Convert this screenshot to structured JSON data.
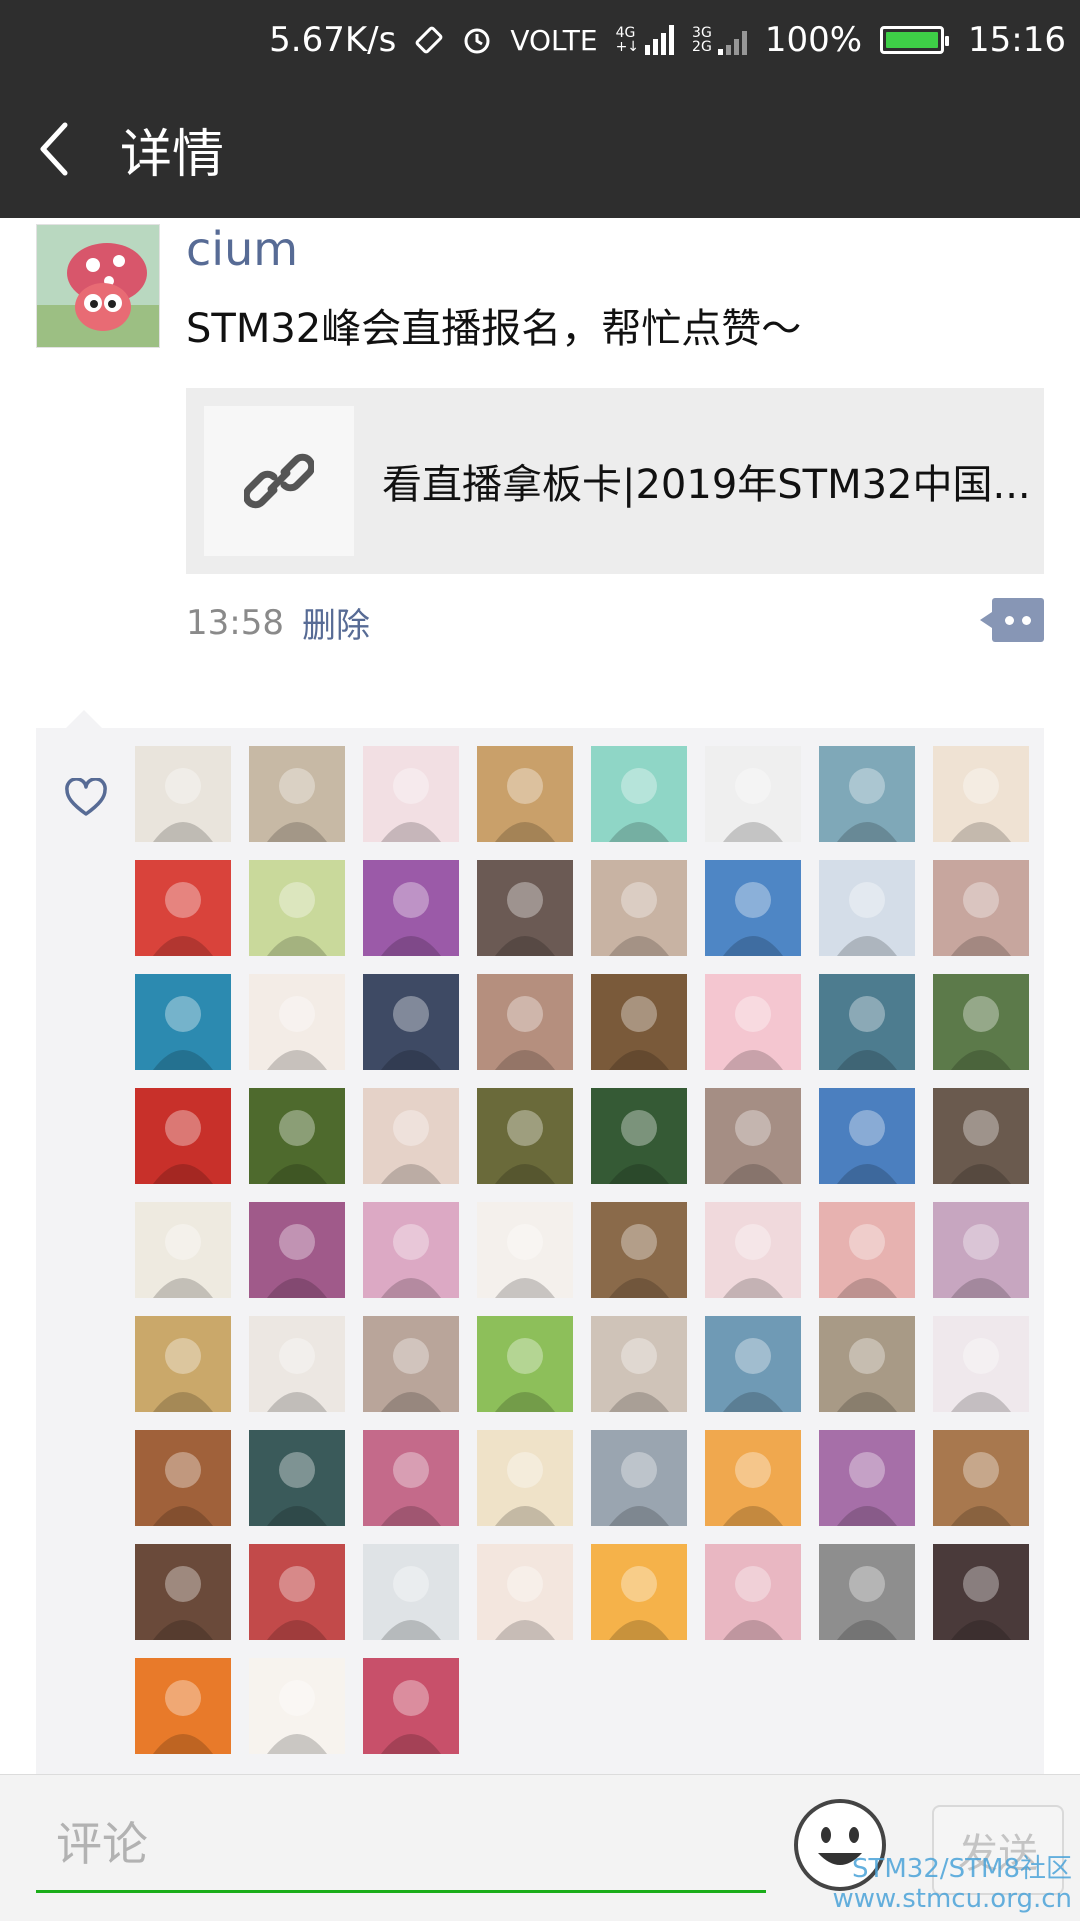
{
  "status_bar": {
    "speed": "5.67K/s",
    "volte": "VOLTE",
    "sim1_label_top": "4G",
    "sim1_label_bottom": "+↓",
    "sim2_label_top": "3G",
    "sim2_label_bottom": "2G",
    "battery": "100%",
    "battery_level": 1.0,
    "time": "15:16",
    "icons": [
      "rotate-icon",
      "alarm-icon",
      "signal-icon",
      "battery-icon"
    ]
  },
  "header": {
    "title": "详情"
  },
  "post": {
    "username": "cium",
    "text": "STM32峰会直播报名，帮忙点赞～",
    "link_title": "看直播拿板卡|2019年STM32中国...",
    "time": "13:58",
    "delete_label": "删除"
  },
  "likes": {
    "count": 67,
    "icon": "heart-icon"
  },
  "comment_bar": {
    "placeholder": "评论",
    "send_label": "发送",
    "emoji_icon": "smiley-icon"
  },
  "watermark": {
    "line1": "STM32/STM8社区",
    "line2": "www.stmcu.org.cn"
  },
  "colors": {
    "header_bg": "#2e2e2e",
    "name_link": "#576b95",
    "accent_green": "#1aad19",
    "panel_bg": "#f3f3f5"
  }
}
